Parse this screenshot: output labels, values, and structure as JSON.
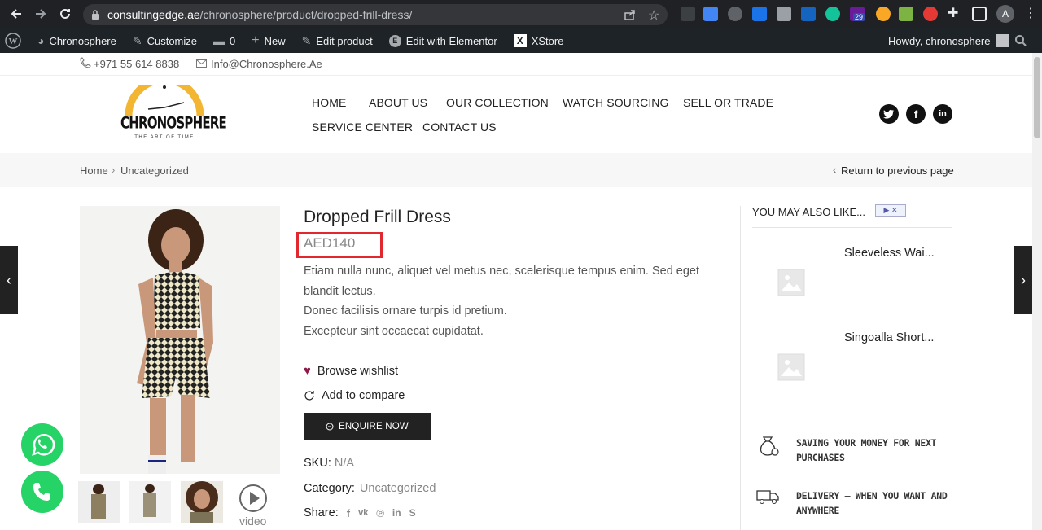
{
  "browser": {
    "url_host": "consultingedge.ae",
    "url_path": "/chronosphere/product/dropped-frill-dress/",
    "profile_initial": "A",
    "ext_badge": "29"
  },
  "admin_bar": {
    "site": "Chronosphere",
    "customize": "Customize",
    "comments": "0",
    "new": "New",
    "edit_product": "Edit product",
    "elementor": "Edit with Elementor",
    "xstore": "XStore",
    "howdy": "Howdy, chronosphere"
  },
  "topbar": {
    "phone": "+971 55 614 8838",
    "email": "Info@Chronosphere.Ae"
  },
  "logo": {
    "name": "CHRONOSPHERE",
    "tagline": "THE ART OF TIME"
  },
  "menu": {
    "home": "HOME",
    "about": "ABOUT US",
    "collection": "OUR COLLECTION",
    "sourcing": "WATCH SOURCING",
    "sell": "SELL OR TRADE",
    "service": "SERVICE CENTER",
    "contact": "CONTACT US"
  },
  "breadcrumb": {
    "home": "Home",
    "sep": "›",
    "current": "Uncategorized",
    "return": "Return to previous page"
  },
  "product": {
    "title": "Dropped Frill Dress",
    "price": "AED140",
    "desc1": "Etiam nulla nunc, aliquet vel metus nec, scelerisque tempus enim. Sed eget",
    "desc2": "blandit lectus.",
    "desc3": "Donec facilisis ornare turpis id pretium.",
    "desc4": "Excepteur sint occaecat cupidatat.",
    "wishlist": "Browse wishlist",
    "compare": "Add to compare",
    "enquire": "ENQUIRE NOW",
    "sku_label": "SKU:",
    "sku_value": "N/A",
    "category_label": "Category:",
    "category_value": "Uncategorized",
    "share_label": "Share:",
    "video_label": "video"
  },
  "sidebar": {
    "title": "YOU MAY ALSO LIKE...",
    "item1": "Sleeveless Wai...",
    "item2": "Singoalla Short...",
    "feature1_line1": "SAVING YOUR MONEY FOR NEXT",
    "feature1_line2": "PURCHASES",
    "feature2_line1": "DELIVERY – WHEN YOU WANT AND",
    "feature2_line2": "ANYWHERE"
  },
  "colors": {
    "accent_highlight": "#e0282e",
    "wishlist_heart": "#8b1c4a",
    "button_dark": "#222222",
    "whatsapp_green": "#25d366"
  }
}
